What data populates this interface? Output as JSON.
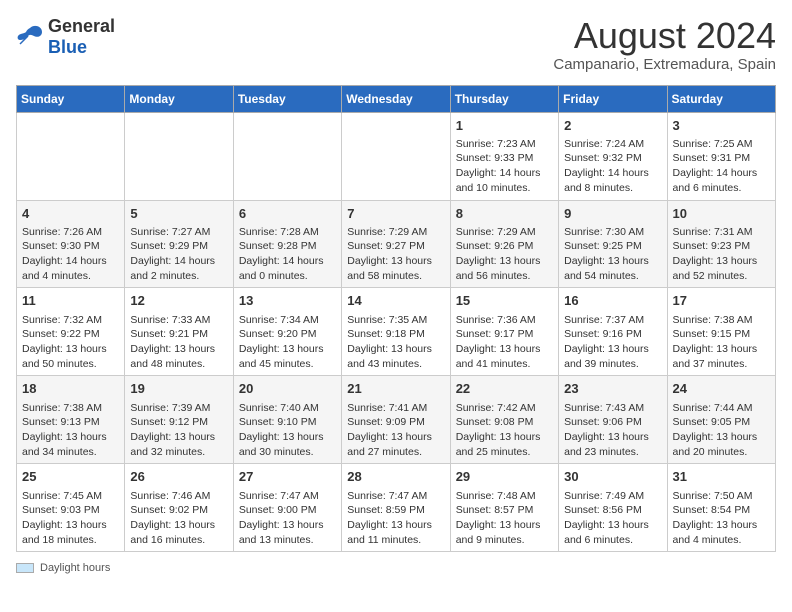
{
  "header": {
    "logo_general": "General",
    "logo_blue": "Blue",
    "main_title": "August 2024",
    "subtitle": "Campanario, Extremadura, Spain"
  },
  "footer": {
    "label": "Daylight hours"
  },
  "calendar": {
    "days_of_week": [
      "Sunday",
      "Monday",
      "Tuesday",
      "Wednesday",
      "Thursday",
      "Friday",
      "Saturday"
    ],
    "weeks": [
      [
        {
          "day": "",
          "info": ""
        },
        {
          "day": "",
          "info": ""
        },
        {
          "day": "",
          "info": ""
        },
        {
          "day": "",
          "info": ""
        },
        {
          "day": "1",
          "info": "Sunrise: 7:23 AM\nSunset: 9:33 PM\nDaylight: 14 hours and 10 minutes."
        },
        {
          "day": "2",
          "info": "Sunrise: 7:24 AM\nSunset: 9:32 PM\nDaylight: 14 hours and 8 minutes."
        },
        {
          "day": "3",
          "info": "Sunrise: 7:25 AM\nSunset: 9:31 PM\nDaylight: 14 hours and 6 minutes."
        }
      ],
      [
        {
          "day": "4",
          "info": "Sunrise: 7:26 AM\nSunset: 9:30 PM\nDaylight: 14 hours and 4 minutes."
        },
        {
          "day": "5",
          "info": "Sunrise: 7:27 AM\nSunset: 9:29 PM\nDaylight: 14 hours and 2 minutes."
        },
        {
          "day": "6",
          "info": "Sunrise: 7:28 AM\nSunset: 9:28 PM\nDaylight: 14 hours and 0 minutes."
        },
        {
          "day": "7",
          "info": "Sunrise: 7:29 AM\nSunset: 9:27 PM\nDaylight: 13 hours and 58 minutes."
        },
        {
          "day": "8",
          "info": "Sunrise: 7:29 AM\nSunset: 9:26 PM\nDaylight: 13 hours and 56 minutes."
        },
        {
          "day": "9",
          "info": "Sunrise: 7:30 AM\nSunset: 9:25 PM\nDaylight: 13 hours and 54 minutes."
        },
        {
          "day": "10",
          "info": "Sunrise: 7:31 AM\nSunset: 9:23 PM\nDaylight: 13 hours and 52 minutes."
        }
      ],
      [
        {
          "day": "11",
          "info": "Sunrise: 7:32 AM\nSunset: 9:22 PM\nDaylight: 13 hours and 50 minutes."
        },
        {
          "day": "12",
          "info": "Sunrise: 7:33 AM\nSunset: 9:21 PM\nDaylight: 13 hours and 48 minutes."
        },
        {
          "day": "13",
          "info": "Sunrise: 7:34 AM\nSunset: 9:20 PM\nDaylight: 13 hours and 45 minutes."
        },
        {
          "day": "14",
          "info": "Sunrise: 7:35 AM\nSunset: 9:18 PM\nDaylight: 13 hours and 43 minutes."
        },
        {
          "day": "15",
          "info": "Sunrise: 7:36 AM\nSunset: 9:17 PM\nDaylight: 13 hours and 41 minutes."
        },
        {
          "day": "16",
          "info": "Sunrise: 7:37 AM\nSunset: 9:16 PM\nDaylight: 13 hours and 39 minutes."
        },
        {
          "day": "17",
          "info": "Sunrise: 7:38 AM\nSunset: 9:15 PM\nDaylight: 13 hours and 37 minutes."
        }
      ],
      [
        {
          "day": "18",
          "info": "Sunrise: 7:38 AM\nSunset: 9:13 PM\nDaylight: 13 hours and 34 minutes."
        },
        {
          "day": "19",
          "info": "Sunrise: 7:39 AM\nSunset: 9:12 PM\nDaylight: 13 hours and 32 minutes."
        },
        {
          "day": "20",
          "info": "Sunrise: 7:40 AM\nSunset: 9:10 PM\nDaylight: 13 hours and 30 minutes."
        },
        {
          "day": "21",
          "info": "Sunrise: 7:41 AM\nSunset: 9:09 PM\nDaylight: 13 hours and 27 minutes."
        },
        {
          "day": "22",
          "info": "Sunrise: 7:42 AM\nSunset: 9:08 PM\nDaylight: 13 hours and 25 minutes."
        },
        {
          "day": "23",
          "info": "Sunrise: 7:43 AM\nSunset: 9:06 PM\nDaylight: 13 hours and 23 minutes."
        },
        {
          "day": "24",
          "info": "Sunrise: 7:44 AM\nSunset: 9:05 PM\nDaylight: 13 hours and 20 minutes."
        }
      ],
      [
        {
          "day": "25",
          "info": "Sunrise: 7:45 AM\nSunset: 9:03 PM\nDaylight: 13 hours and 18 minutes."
        },
        {
          "day": "26",
          "info": "Sunrise: 7:46 AM\nSunset: 9:02 PM\nDaylight: 13 hours and 16 minutes."
        },
        {
          "day": "27",
          "info": "Sunrise: 7:47 AM\nSunset: 9:00 PM\nDaylight: 13 hours and 13 minutes."
        },
        {
          "day": "28",
          "info": "Sunrise: 7:47 AM\nSunset: 8:59 PM\nDaylight: 13 hours and 11 minutes."
        },
        {
          "day": "29",
          "info": "Sunrise: 7:48 AM\nSunset: 8:57 PM\nDaylight: 13 hours and 9 minutes."
        },
        {
          "day": "30",
          "info": "Sunrise: 7:49 AM\nSunset: 8:56 PM\nDaylight: 13 hours and 6 minutes."
        },
        {
          "day": "31",
          "info": "Sunrise: 7:50 AM\nSunset: 8:54 PM\nDaylight: 13 hours and 4 minutes."
        }
      ]
    ]
  }
}
